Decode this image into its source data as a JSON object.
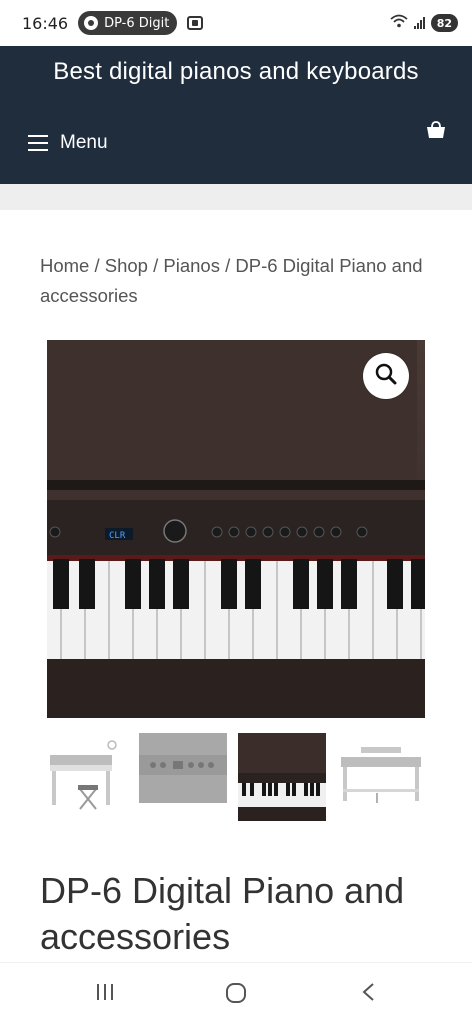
{
  "status_bar": {
    "time": "16:46",
    "tab_title": "DP-6 Digit",
    "battery": "82"
  },
  "header": {
    "site_title": "Best digital pianos and keyboards",
    "menu_label": "Menu",
    "background": "#1f2d3d"
  },
  "breadcrumb": {
    "text": "Home / Shop / Pianos / DP-6 Digital Piano and accessories",
    "items": [
      "Home",
      "Shop",
      "Pianos",
      "DP-6 Digital Piano and accessories"
    ]
  },
  "product": {
    "title": "DP-6 Digital Piano and accessories",
    "display_text": "CLR",
    "thumbnail_count": 4
  },
  "icons": {
    "menu": "hamburger-icon",
    "cart": "shopping-bag-icon",
    "zoom": "search-icon",
    "nav_recent": "recent-apps-icon",
    "nav_home": "home-icon",
    "nav_back": "back-icon"
  }
}
